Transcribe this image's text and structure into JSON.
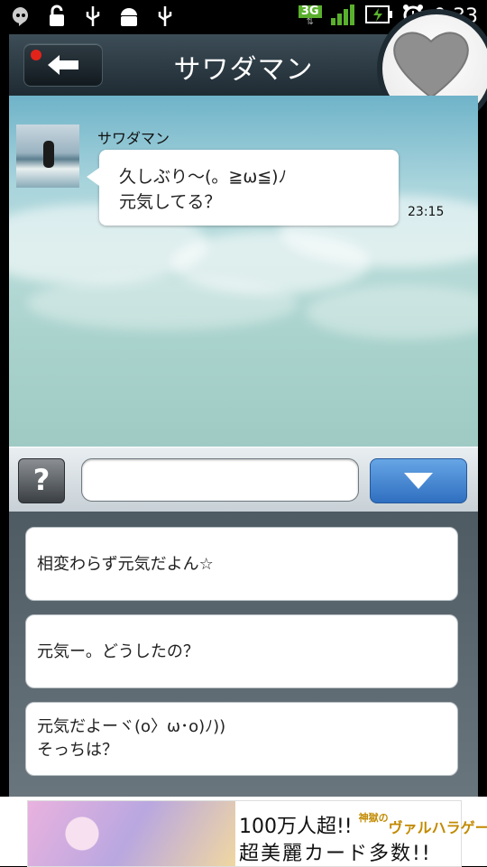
{
  "status_bar": {
    "network": "3G",
    "time": "0:33",
    "icons": [
      "hangouts-icon",
      "lock-open-icon",
      "usb-icon",
      "android-debug-icon",
      "usb-icon",
      "signal-icon",
      "battery-charging-icon",
      "alarm-icon"
    ]
  },
  "header": {
    "title": "サワダマン",
    "back_icon": "arrow-left-icon",
    "favorite_icon": "heart-icon"
  },
  "chat": {
    "messages": [
      {
        "sender": "サワダマン",
        "text": "久しぶり〜(。≧ω≦)ﾉ\n元気してる？",
        "time": "23:15"
      }
    ]
  },
  "input": {
    "help_label": "?",
    "value": "",
    "placeholder": ""
  },
  "options": [
    "相変わらず元気だよん☆",
    "元気ー。どうしたの？",
    "元気だよーヾ(o〉ω･o)ﾉ))\nそっちは？"
  ],
  "ad": {
    "line1": "100万人超!!",
    "brand": "ヴァルハラゲート",
    "brand_prefix": "神獄の",
    "line2": "超美麗カード多数!!"
  },
  "colors": {
    "accent_blue": "#2f6fc0",
    "header_dark": "#1f2b33",
    "recording_red": "#e2231a",
    "badge_green": "#5ab02d"
  }
}
